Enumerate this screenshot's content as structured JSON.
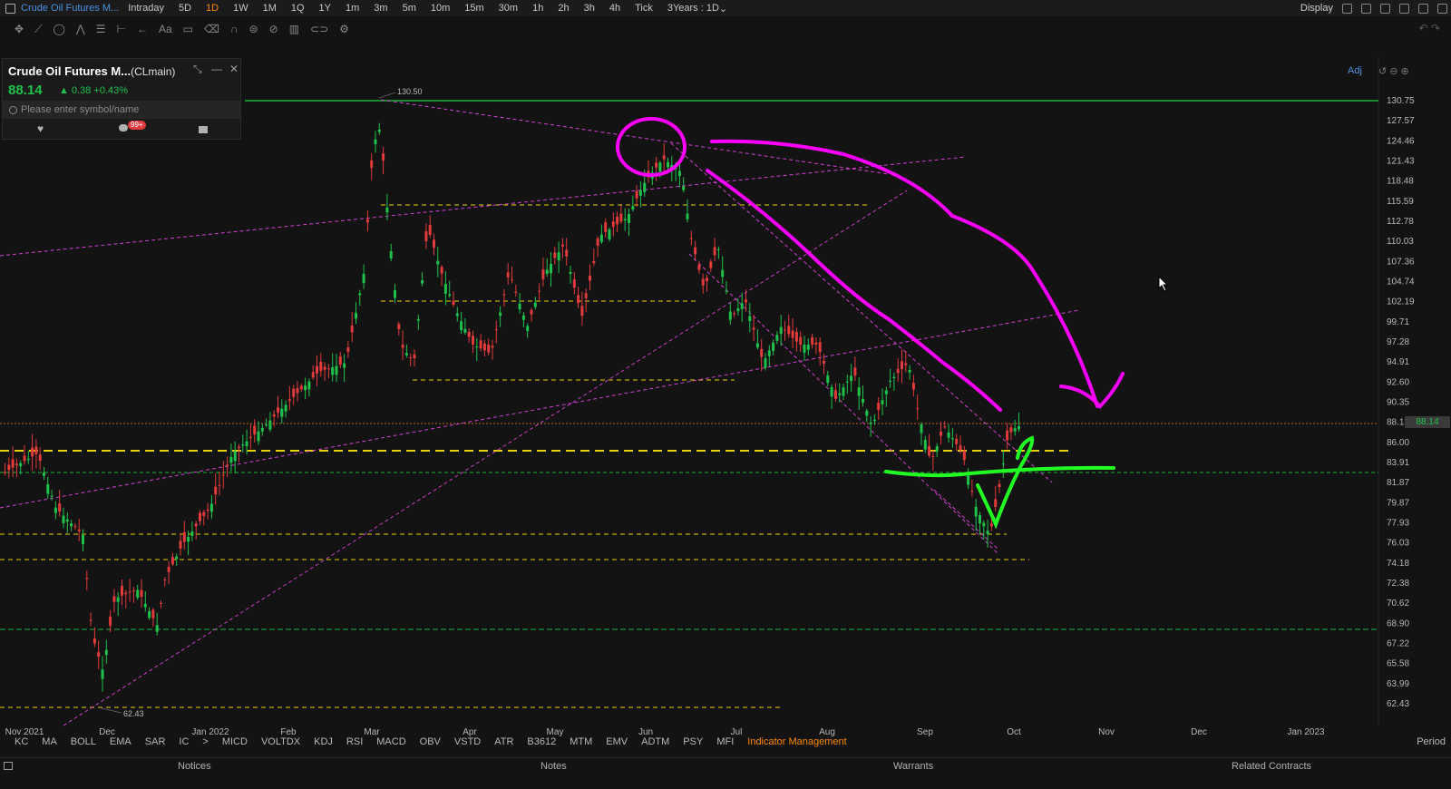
{
  "topbar": {
    "title": "Crude Oil Futures M...",
    "periods": [
      "Intraday",
      "5D",
      "1D",
      "1W",
      "1M",
      "1Q",
      "1Y",
      "1m",
      "3m",
      "5m",
      "10m",
      "15m",
      "30m",
      "1h",
      "2h",
      "3h",
      "4h",
      "Tick"
    ],
    "active_period": "1D",
    "range": "3Years : 1D",
    "display": "Display"
  },
  "symbol_card": {
    "name": "Crude Oil Futures M...",
    "code": "(CLmain)",
    "price": "88.14",
    "change": "▲ 0.38 +0.43%",
    "search_placeholder": "Please enter symbol/name",
    "badge": "99+"
  },
  "adj_label": "Adj",
  "chart": {
    "y_ticks": [
      "130.75",
      "127.57",
      "124.46",
      "121.43",
      "118.48",
      "115.59",
      "112.78",
      "110.03",
      "107.36",
      "104.74",
      "102.19",
      "99.71",
      "97.28",
      "94.91",
      "92.60",
      "90.35",
      "88.14",
      "86.00",
      "83.91",
      "81.87",
      "79.87",
      "77.93",
      "76.03",
      "74.18",
      "72.38",
      "70.62",
      "68.90",
      "67.22",
      "65.58",
      "63.99",
      "62.43"
    ],
    "x_ticks": [
      "Nov 2021",
      "Dec",
      "Jan 2022",
      "Feb",
      "Mar",
      "Apr",
      "May",
      "Jun",
      "Jul",
      "Aug",
      "Sep",
      "Oct",
      "Nov",
      "Dec",
      "Jan 2023"
    ],
    "high_label": "130.50",
    "low_label": "62.43",
    "last_price": "88.14",
    "colors": {
      "up": "#1ec24b",
      "down": "#e23b3b",
      "magenta": "#ff00ff",
      "green_annot": "#22ff22",
      "yellow": "#e6d200"
    }
  },
  "indicators": [
    "KC",
    "MA",
    "BOLL",
    "EMA",
    "SAR",
    "IC",
    ">",
    "MICD",
    "VOLTDX",
    "KDJ",
    "RSI",
    "MACD",
    "OBV",
    "VSTD",
    "ATR",
    "B3612",
    "MTM",
    "EMV",
    "ADTM",
    "PSY",
    "MFI"
  ],
  "indicator_management": "Indicator Management",
  "period_label": "Period",
  "bottom_tabs": [
    "Notices",
    "Notes",
    "Warrants",
    "Related Contracts"
  ]
}
